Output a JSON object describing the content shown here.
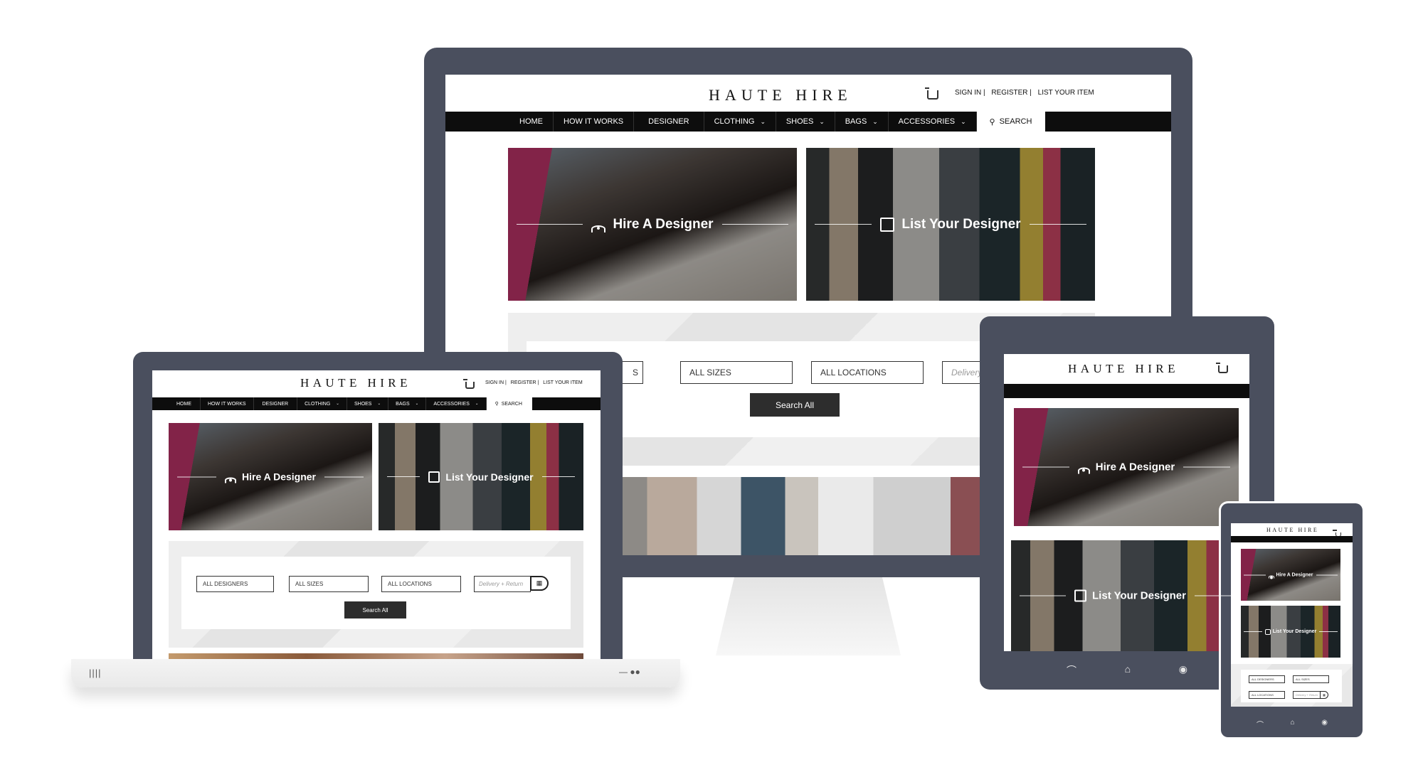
{
  "brand": {
    "logo": "HAUTE HIRE"
  },
  "header_links": {
    "sign_in": "SIGN IN |",
    "register": "REGISTER |",
    "list_item": "LIST YOUR ITEM"
  },
  "nav": {
    "home": "HOME",
    "how_it_works": "HOW IT WORKS",
    "designer": "DESIGNER",
    "clothing": "CLOTHING",
    "shoes": "SHOES",
    "bags": "BAGS",
    "accessories": "ACCESSORIES",
    "search": "SEARCH",
    "chevron": "⌄"
  },
  "hero": {
    "hire": "Hire A Designer",
    "list": "List Your Designer"
  },
  "filters": {
    "designers": "ALL DESIGNERS",
    "sizes": "ALL SIZES",
    "locations": "ALL LOCATIONS",
    "delivery_placeholder": "Delivery + Return",
    "monitor_delivery_placeholder": "Delivery",
    "partial_designers": "S",
    "search_button": "Search All",
    "calendar_glyph": "▦"
  },
  "laptop_base": {
    "left_glyph": "||||",
    "right_glyph": "— ●●"
  },
  "tablet_nav": {
    "back": "⌒",
    "home": "⌂",
    "view": "◉"
  },
  "colors": {
    "frame": "#4a4f5e",
    "nav": "#0d0d0d",
    "accent_pink": "#c8366f"
  },
  "icons": [
    "cart-icon",
    "person-icon",
    "shirt-icon",
    "search-icon",
    "calendar-icon"
  ]
}
